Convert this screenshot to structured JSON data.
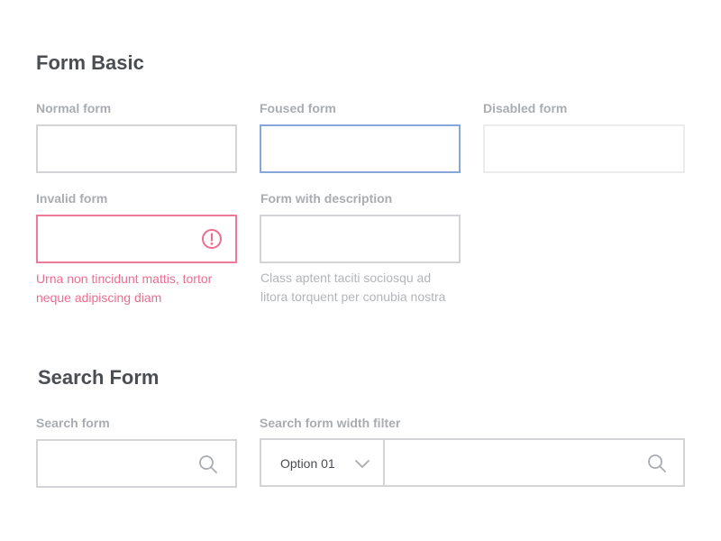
{
  "form_basic": {
    "title": "Form Basic",
    "normal": {
      "label": "Normal form",
      "value": "",
      "placeholder": ""
    },
    "focused": {
      "label": "Foused form",
      "value": "",
      "placeholder": ""
    },
    "disabled": {
      "label": "Disabled form",
      "value": "",
      "placeholder": ""
    },
    "invalid": {
      "label": "Invalid form",
      "value": "",
      "error_line1": "Urna non tincidunt mattis, tortor",
      "error_line2": "neque adipiscing diam"
    },
    "description": {
      "label": "Form with description",
      "value": "",
      "desc_line1": "Class aptent taciti sociosqu ad",
      "desc_line2": "litora torquent per conubia nostra"
    }
  },
  "search_form": {
    "title": "Search Form",
    "search": {
      "label": "Search form",
      "value": "",
      "placeholder": ""
    },
    "filter": {
      "label": "Search form width filter",
      "selected_option": "Option 01",
      "value": "",
      "placeholder": ""
    }
  },
  "icons": {
    "error": "exclamation-circle-icon",
    "search": "search-icon",
    "dropdown": "chevron-down-icon"
  },
  "colors": {
    "focus": "#86a8d8",
    "error": "#ee6d8f",
    "border": "#d2d4d7",
    "disabled_border": "#ebecee",
    "title": "#4a4d52",
    "label": "#a9acb0"
  }
}
